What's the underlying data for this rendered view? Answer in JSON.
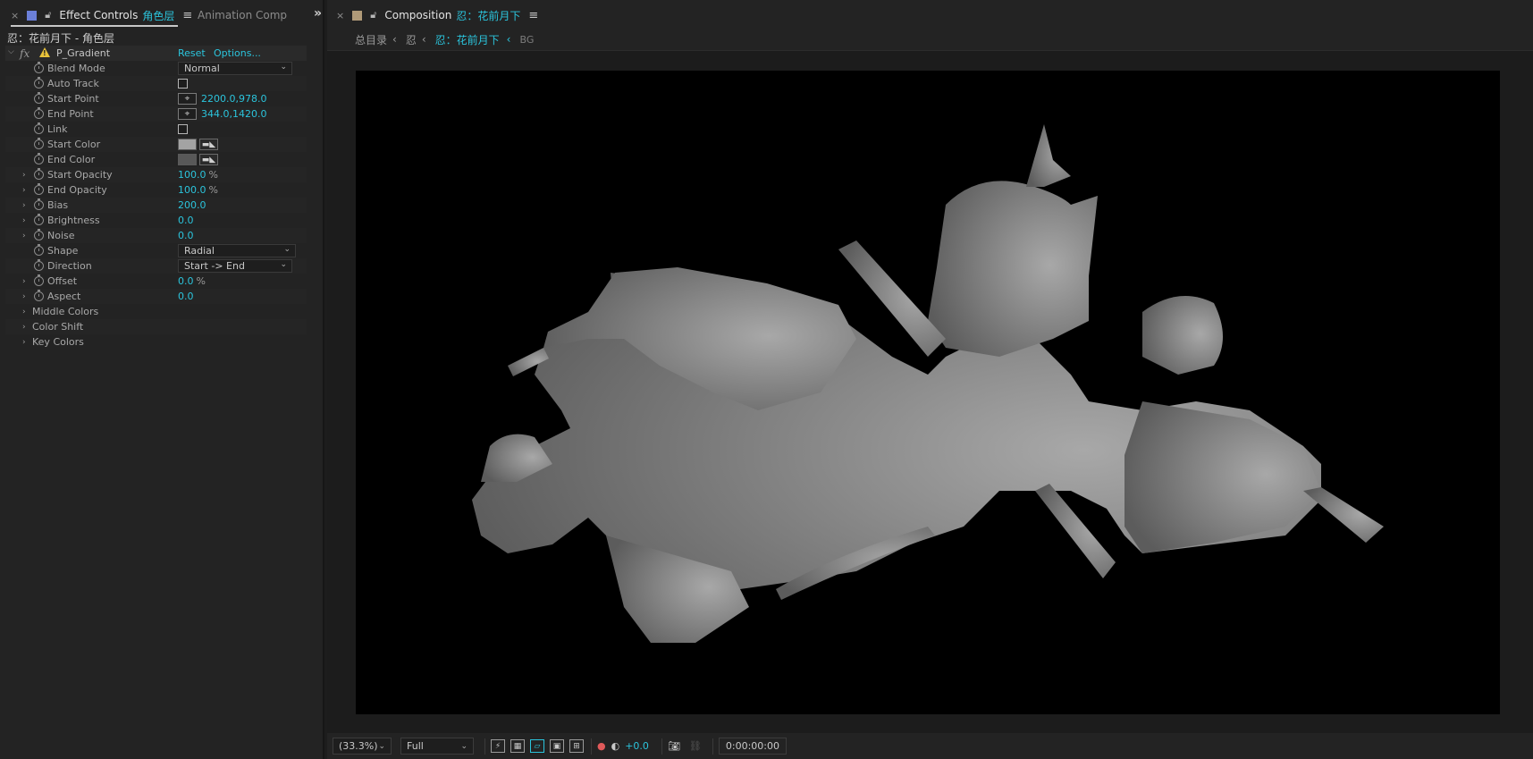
{
  "effect_controls_panel": {
    "tab_title": "Effect Controls",
    "tab_layer": "角色层",
    "tab_inactive": "Animation Compose",
    "layer_path": "忍：花前月下 - 角色层",
    "effect": {
      "fx": "fx",
      "name": "P_Gradient",
      "reset_label": "Reset",
      "options_label": "Options..."
    },
    "properties": {
      "blend_mode": {
        "label": "Blend Mode",
        "value": "Normal"
      },
      "auto_track": {
        "label": "Auto Track"
      },
      "start_point": {
        "label": "Start Point",
        "value": "2200.0,978.0"
      },
      "end_point": {
        "label": "End Point",
        "value": "344.0,1420.0"
      },
      "link": {
        "label": "Link"
      },
      "start_color": {
        "label": "Start Color",
        "color": "#a3a3a3"
      },
      "end_color": {
        "label": "End Color",
        "color": "#585858"
      },
      "start_opacity": {
        "label": "Start Opacity",
        "value": "100.0",
        "unit": "%"
      },
      "end_opacity": {
        "label": "End Opacity",
        "value": "100.0",
        "unit": "%"
      },
      "bias": {
        "label": "Bias",
        "value": "200.0"
      },
      "brightness": {
        "label": "Brightness",
        "value": "0.0"
      },
      "noise": {
        "label": "Noise",
        "value": "0.0"
      },
      "shape": {
        "label": "Shape",
        "value": "Radial"
      },
      "direction": {
        "label": "Direction",
        "value": "Start -> End"
      },
      "offset": {
        "label": "Offset",
        "value": "0.0",
        "unit": "%"
      },
      "aspect": {
        "label": "Aspect",
        "value": "0.0"
      }
    },
    "groups": {
      "middle_colors": "Middle Colors",
      "color_shift": "Color Shift",
      "key_colors": "Key Colors"
    }
  },
  "composition_panel": {
    "tab_title": "Composition",
    "comp_name": "忍：花前月下",
    "breadcrumb": {
      "root": "总目录",
      "parent": "忍",
      "current": "忍：花前月下",
      "next": "BG"
    },
    "footer": {
      "magnification": "(33.3%)",
      "resolution": "Full",
      "exposure": "+0.0",
      "timecode": "0:00:00:00"
    }
  },
  "colors": {
    "accent": "#2bc4dc",
    "panel_bg": "#232323",
    "canvas_bg": "#000000",
    "silhouette": "#8f8f8f"
  }
}
